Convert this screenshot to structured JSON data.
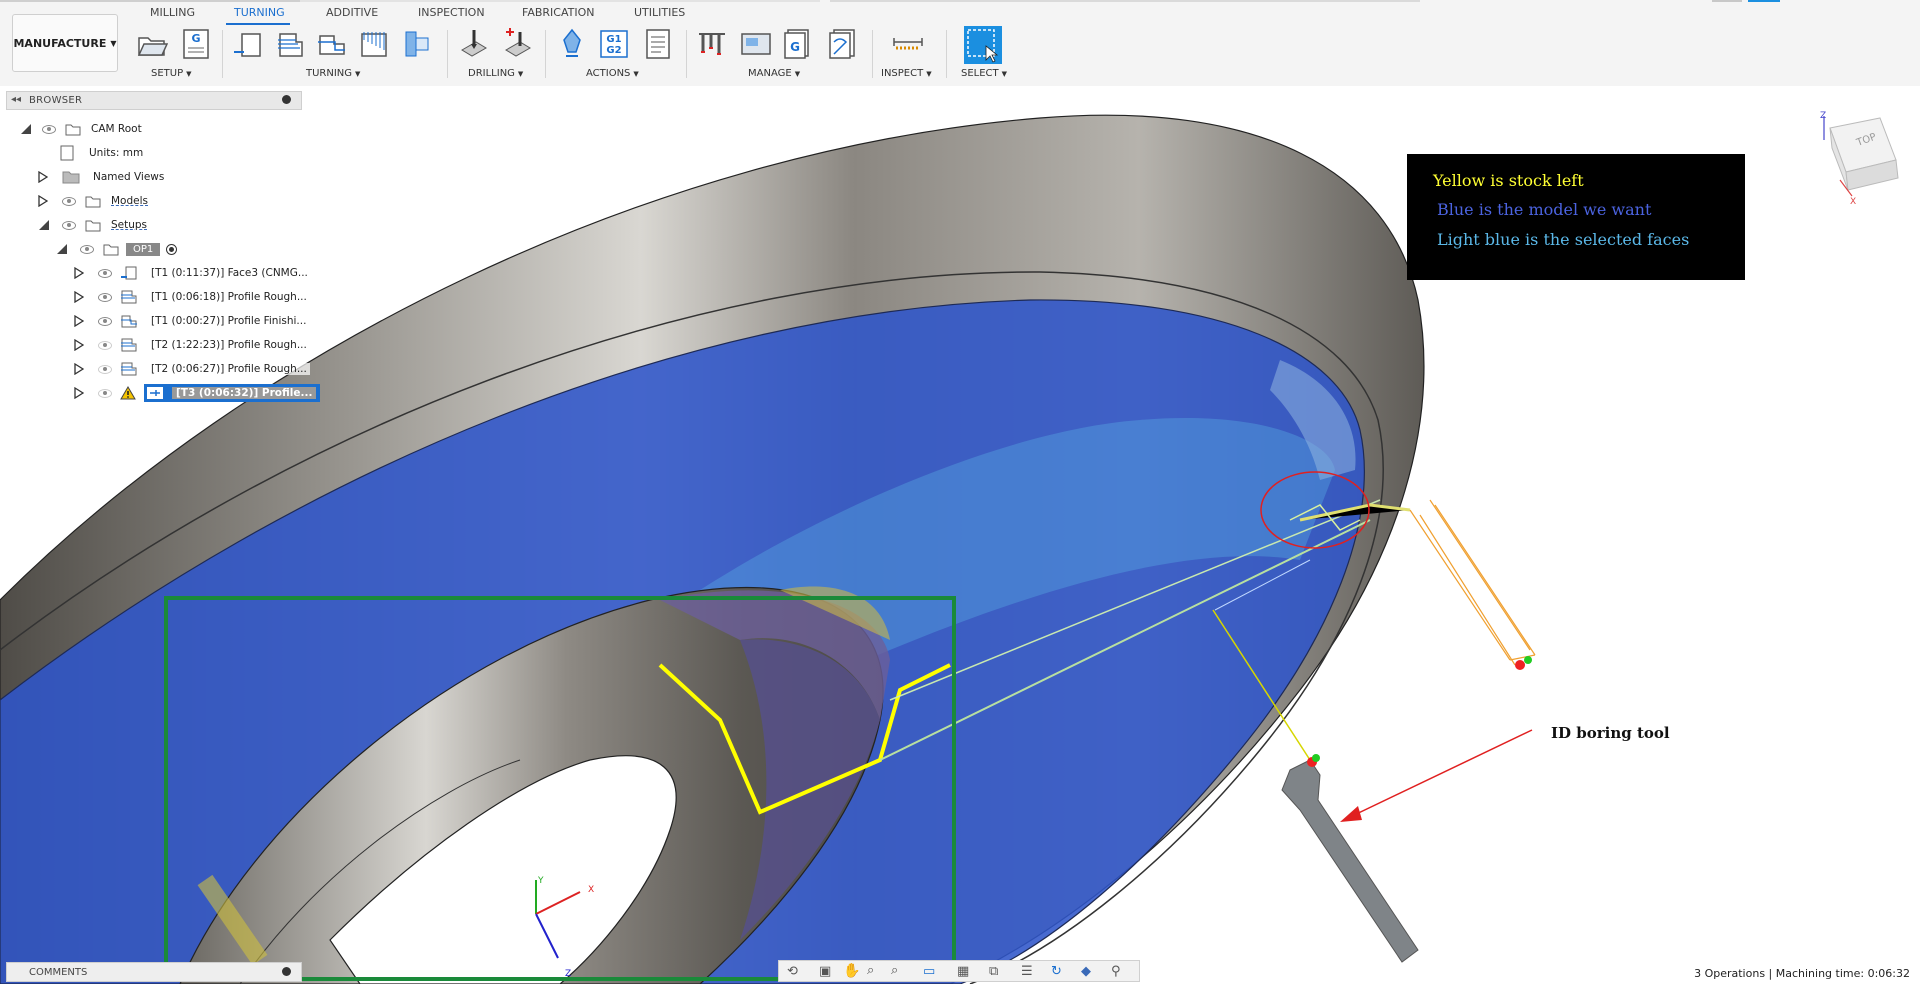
{
  "workspace": {
    "label": "MANUFACTURE"
  },
  "tabs": [
    {
      "label": "MILLING"
    },
    {
      "label": "TURNING"
    },
    {
      "label": "ADDITIVE"
    },
    {
      "label": "INSPECTION"
    },
    {
      "label": "FABRICATION"
    },
    {
      "label": "UTILITIES"
    }
  ],
  "groups": {
    "setup": "SETUP",
    "turning": "TURNING",
    "drilling": "DRILLING",
    "actions": "ACTIONS",
    "manage": "MANAGE",
    "inspect": "INSPECT",
    "select": "SELECT"
  },
  "tool_icon_text": {
    "g": "G",
    "g1g2": "G1\nG2"
  },
  "browser": {
    "title": "BROWSER",
    "root": "CAM Root",
    "units": "Units: mm",
    "named_views": "Named Views",
    "models": "Models",
    "setups": "Setups",
    "op": "OP1",
    "operations": [
      {
        "label": "[T1 (0:11:37)] Face3 (CNMG..."
      },
      {
        "label": "[T1 (0:06:18)] Profile Rough..."
      },
      {
        "label": "[T1 (0:00:27)] Profile Finishi..."
      },
      {
        "label": "[T2 (1:22:23)] Profile Rough..."
      },
      {
        "label": "[T2 (0:06:27)] Profile Rough..."
      },
      {
        "label": "[T3 (0:06:32)] Profile..."
      }
    ]
  },
  "legend": {
    "yellow": "Yellow is stock left",
    "blue": "Blue is the model we want",
    "light_blue": "Light blue is the selected faces"
  },
  "annotation": {
    "tool": "ID boring tool"
  },
  "viewcube": {
    "face": "TOP",
    "x": "X",
    "z": "Z"
  },
  "triad": {
    "x": "X",
    "y": "Y",
    "z": "Z"
  },
  "comments": {
    "label": "COMMENTS"
  },
  "status": {
    "text": "3 Operations | Machining time: 0:06:32"
  },
  "colors": {
    "accent": "#1b6fcf",
    "stock_yellow": "#ffff00",
    "model_blue": "#3b5bd6",
    "selected_light_blue": "#5bb8e8",
    "highlight_green": "#1a8a3a",
    "circle_red": "#e02020"
  }
}
